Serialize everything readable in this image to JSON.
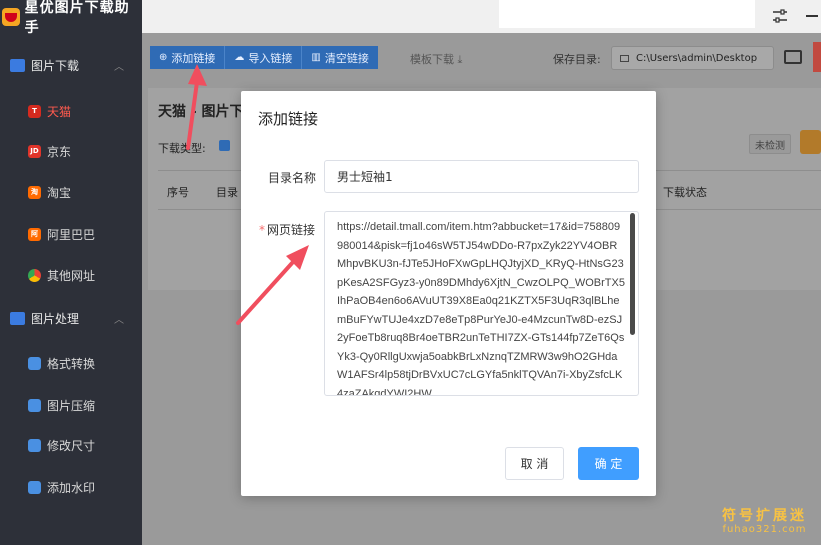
{
  "app": {
    "title": "星优图片下载助手"
  },
  "sidebar": {
    "groups": [
      {
        "label": "图片下载",
        "icon": "image-download-icon",
        "color": "#3b7be0"
      },
      {
        "label": "图片处理",
        "icon": "image-process-icon",
        "color": "#3b7be0"
      }
    ],
    "items": [
      {
        "label": "天猫",
        "icon": "tmall-icon",
        "glyph": "T",
        "color": "#d62a1f",
        "active": true
      },
      {
        "label": "京东",
        "icon": "jd-icon",
        "glyph": "JD",
        "color": "#e0342a",
        "active": false
      },
      {
        "label": "淘宝",
        "icon": "taobao-icon",
        "glyph": "淘",
        "color": "#ff6a00",
        "active": false
      },
      {
        "label": "阿里巴巴",
        "icon": "alibaba-icon",
        "glyph": "阿",
        "color": "#ff6a00",
        "active": false
      },
      {
        "label": "其他网址",
        "icon": "chrome-icon",
        "glyph": "",
        "color": "#34a853",
        "active": false
      },
      {
        "label": "格式转换",
        "icon": "format-convert-icon",
        "glyph": "",
        "color": "#4a90e2",
        "active": false
      },
      {
        "label": "图片压缩",
        "icon": "compress-icon",
        "glyph": "",
        "color": "#4a90e2",
        "active": false
      },
      {
        "label": "修改尺寸",
        "icon": "resize-icon",
        "glyph": "",
        "color": "#4a90e2",
        "active": false
      },
      {
        "label": "添加水印",
        "icon": "watermark-icon",
        "glyph": "",
        "color": "#4a90e2",
        "active": false
      }
    ]
  },
  "toolbar": {
    "add_link": "添加链接",
    "import_link": "导入链接",
    "clear_link": "清空链接",
    "template_download": "模板下载",
    "save_dir_label": "保存目录:",
    "save_dir_value": "C:\\Users\\admin\\Desktop"
  },
  "content": {
    "title": "天猫 - 图片下",
    "download_type_label": "下载类型:",
    "status_badge": "未检测",
    "col_index": "序号",
    "col_dir": "目录",
    "col_status": "下载状态"
  },
  "modal": {
    "title": "添加链接",
    "dir_name_label": "目录名称",
    "dir_name_value": "男士短袖1",
    "url_label": "网页链接",
    "url_value": "https://detail.tmall.com/item.htm?abbucket=17&id=758809980014&pisk=fj1o46sW5TJ54wDDo-R7pxZyk22YV4OBRMhpvBKU3n-fJTe5JHoFXwGpLHQJtyjXD_KRyQ-HtNsG23pKesA2SFGyz3-y0n89DMhdy6XjtN_CwzOLPQ_WOBrTX5IhPaOB4en6o6AVuUT39X8Ea0q21KZTX5F3UqR3qlBLhemBuFYwTUJe4xzD7e8eTp8PurYeJ0-e4MzcunTw8D-ezSJ2yFoeTb8ruq8Br4oeTBR2unTeTHI7ZX-GTs144fp7ZeT6QsYk3-Qy0RllgUxwja5oabkBrLxNznqTZMRW3w9hO2GHdaW1AFSr4lp58tjDrBVxUC7cLGYfa5nklTQVAn7i-XbyZsfcLK4zaZAkqdYWI2HW",
    "cancel": "取 消",
    "ok": "确 定"
  },
  "watermark": {
    "cn": "符号扩展迷",
    "en": "fuhao321.com"
  },
  "colors": {
    "sidebar_bg": "#2d3039",
    "active_red": "#ff5a4e",
    "primary_blue": "#409eff",
    "annotation_arrow": "#f04e5e",
    "watermark_gold": "#f7c244"
  }
}
